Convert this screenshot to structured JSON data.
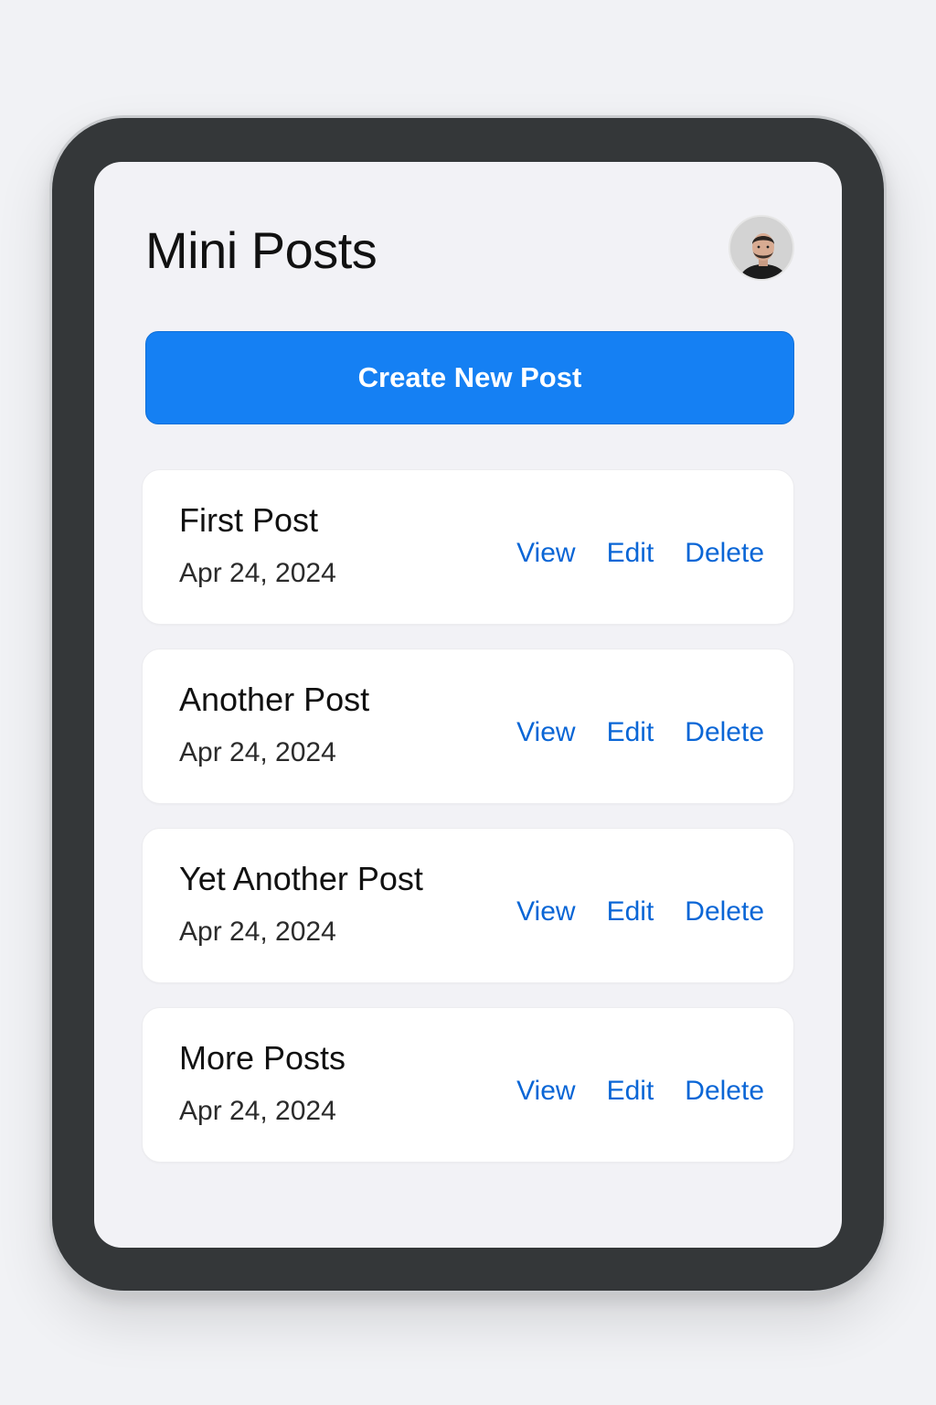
{
  "app": {
    "title": "Mini Posts"
  },
  "header": {
    "avatar_icon": "user-avatar"
  },
  "create_button": {
    "label": "Create New Post",
    "color": "#1580f3"
  },
  "posts": [
    {
      "title": "First Post",
      "date": "Apr 24, 2024",
      "view": "View",
      "edit": "Edit",
      "delete": "Delete"
    },
    {
      "title": "Another Post",
      "date": "Apr 24, 2024",
      "view": "View",
      "edit": "Edit",
      "delete": "Delete"
    },
    {
      "title": "Yet Another Post",
      "date": "Apr 24, 2024",
      "view": "View",
      "edit": "Edit",
      "delete": "Delete"
    },
    {
      "title": "More Posts",
      "date": "Apr 24, 2024",
      "view": "View",
      "edit": "Edit",
      "delete": "Delete"
    }
  ],
  "colors": {
    "link": "#0a66d6",
    "device_frame": "#343739",
    "background": "#f2f2f6"
  }
}
